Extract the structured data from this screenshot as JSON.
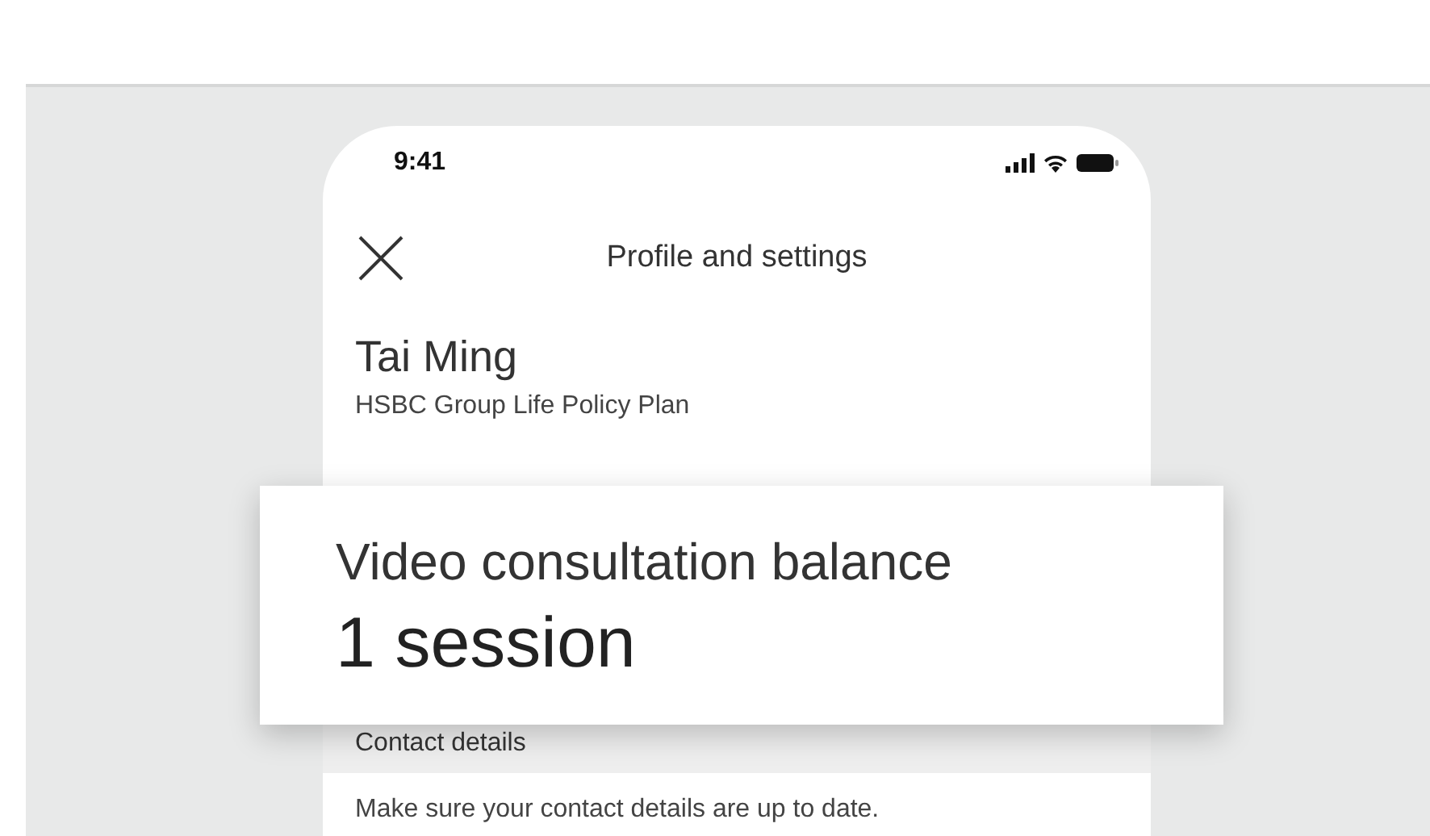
{
  "status_bar": {
    "time": "9:41"
  },
  "header": {
    "title": "Profile and settings"
  },
  "profile": {
    "name": "Tai Ming",
    "plan": "HSBC Group Life Policy Plan"
  },
  "callout": {
    "label": "Video consultation balance",
    "value": "1 session"
  },
  "section": {
    "heading": "Contact details",
    "text": "Make sure your contact details are up to date."
  }
}
